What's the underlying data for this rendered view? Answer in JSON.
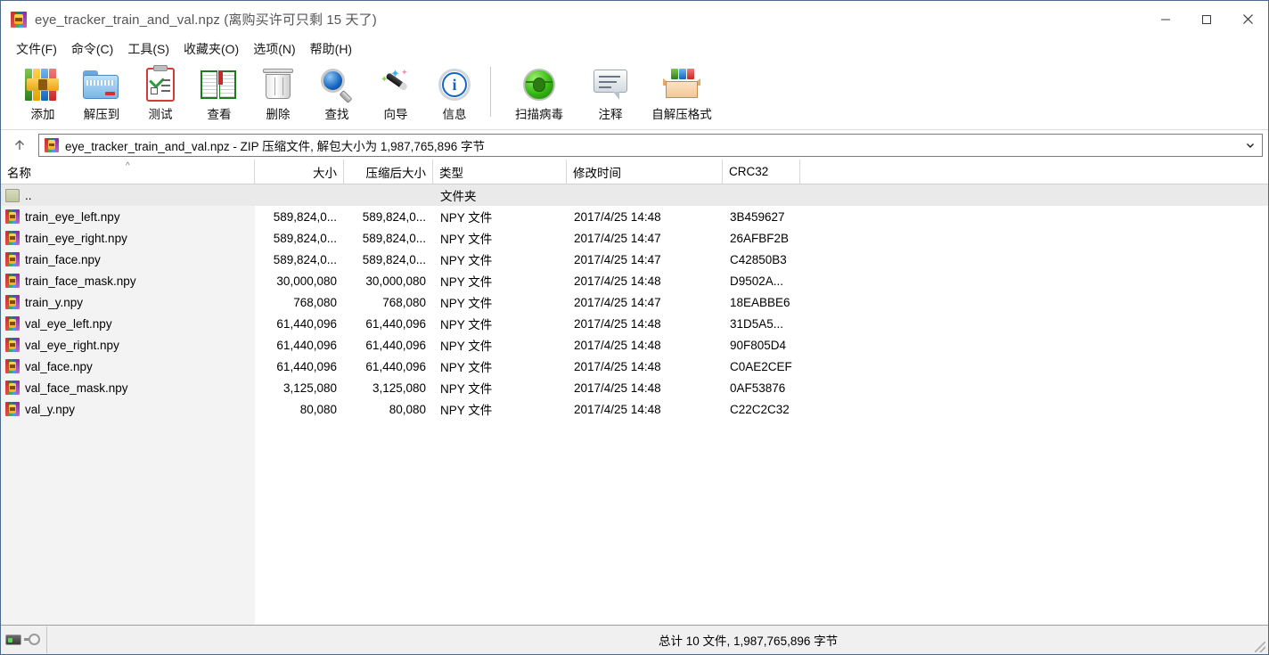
{
  "window": {
    "title": "eye_tracker_train_and_val.npz (离购买许可只剩 15 天了)",
    "app_icon": "winrar-archive-icon",
    "minimize_label": "—",
    "maximize_label": "□",
    "close_label": "✕"
  },
  "menu": {
    "items": [
      {
        "label": "文件(F)",
        "name": "menu-file"
      },
      {
        "label": "命令(C)",
        "name": "menu-commands"
      },
      {
        "label": "工具(S)",
        "name": "menu-tools"
      },
      {
        "label": "收藏夹(O)",
        "name": "menu-favorites"
      },
      {
        "label": "选项(N)",
        "name": "menu-options"
      },
      {
        "label": "帮助(H)",
        "name": "menu-help"
      }
    ]
  },
  "toolbar": {
    "buttons": [
      {
        "label": "添加",
        "icon": "add-archive-icon"
      },
      {
        "label": "解压到",
        "icon": "extract-to-folder-icon"
      },
      {
        "label": "测试",
        "icon": "test-clipboard-icon"
      },
      {
        "label": "查看",
        "icon": "view-book-icon"
      },
      {
        "label": "删除",
        "icon": "delete-trash-icon"
      },
      {
        "label": "查找",
        "icon": "find-magnifier-icon"
      },
      {
        "label": "向导",
        "icon": "wizard-wand-icon"
      },
      {
        "label": "信息",
        "icon": "info-icon"
      },
      {
        "label": "扫描病毒",
        "icon": "virus-scan-bug-icon"
      },
      {
        "label": "注释",
        "icon": "comment-bubble-icon"
      },
      {
        "label": "自解压格式",
        "icon": "sfx-box-icon"
      }
    ]
  },
  "address": {
    "up_icon": "arrow-up-icon",
    "archive_icon": "winrar-archive-icon",
    "text": "eye_tracker_train_and_val.npz - ZIP 压缩文件, 解包大小为 1,987,765,896 字节",
    "dropdown_icon": "chevron-down-icon"
  },
  "columns": [
    {
      "label": "名称",
      "key": "name"
    },
    {
      "label": "大小",
      "key": "size"
    },
    {
      "label": "压缩后大小",
      "key": "packed"
    },
    {
      "label": "类型",
      "key": "type"
    },
    {
      "label": "修改时间",
      "key": "modified"
    },
    {
      "label": "CRC32",
      "key": "crc32"
    }
  ],
  "sort": {
    "column": "名称",
    "indicator": "^"
  },
  "files": [
    {
      "name": "..",
      "icon": "parent-folder-icon",
      "size": "",
      "packed": "",
      "type": "文件夹",
      "modified": "",
      "crc32": "",
      "is_parent": true
    },
    {
      "name": "train_eye_left.npy",
      "icon": "npy-file-icon",
      "size": "589,824,0...",
      "packed": "589,824,0...",
      "type": "NPY 文件",
      "modified": "2017/4/25 14:48",
      "crc32": "3B459627"
    },
    {
      "name": "train_eye_right.npy",
      "icon": "npy-file-icon",
      "size": "589,824,0...",
      "packed": "589,824,0...",
      "type": "NPY 文件",
      "modified": "2017/4/25 14:47",
      "crc32": "26AFBF2B"
    },
    {
      "name": "train_face.npy",
      "icon": "npy-file-icon",
      "size": "589,824,0...",
      "packed": "589,824,0...",
      "type": "NPY 文件",
      "modified": "2017/4/25 14:47",
      "crc32": "C42850B3"
    },
    {
      "name": "train_face_mask.npy",
      "icon": "npy-file-icon",
      "size": "30,000,080",
      "packed": "30,000,080",
      "type": "NPY 文件",
      "modified": "2017/4/25 14:48",
      "crc32": "D9502A..."
    },
    {
      "name": "train_y.npy",
      "icon": "npy-file-icon",
      "size": "768,080",
      "packed": "768,080",
      "type": "NPY 文件",
      "modified": "2017/4/25 14:47",
      "crc32": "18EABBE6"
    },
    {
      "name": "val_eye_left.npy",
      "icon": "npy-file-icon",
      "size": "61,440,096",
      "packed": "61,440,096",
      "type": "NPY 文件",
      "modified": "2017/4/25 14:48",
      "crc32": "31D5A5..."
    },
    {
      "name": "val_eye_right.npy",
      "icon": "npy-file-icon",
      "size": "61,440,096",
      "packed": "61,440,096",
      "type": "NPY 文件",
      "modified": "2017/4/25 14:48",
      "crc32": "90F805D4"
    },
    {
      "name": "val_face.npy",
      "icon": "npy-file-icon",
      "size": "61,440,096",
      "packed": "61,440,096",
      "type": "NPY 文件",
      "modified": "2017/4/25 14:48",
      "crc32": "C0AE2CEF"
    },
    {
      "name": "val_face_mask.npy",
      "icon": "npy-file-icon",
      "size": "3,125,080",
      "packed": "3,125,080",
      "type": "NPY 文件",
      "modified": "2017/4/25 14:48",
      "crc32": "0AF53876"
    },
    {
      "name": "val_y.npy",
      "icon": "npy-file-icon",
      "size": "80,080",
      "packed": "80,080",
      "type": "NPY 文件",
      "modified": "2017/4/25 14:48",
      "crc32": "C22C2C32"
    }
  ],
  "statusbar": {
    "drive_icon": "drive-icon",
    "key_icon": "key-icon",
    "summary": "总计 10 文件, 1,987,765,896 字节",
    "resize_grip": "resize-grip"
  },
  "colors": {
    "window_border": "#4a6a8a",
    "title_text": "#555555",
    "name_column_bg": "#f3f3f3",
    "parent_row_bg": "#eaeaea",
    "statusbar_bg": "#f0f0f0"
  }
}
